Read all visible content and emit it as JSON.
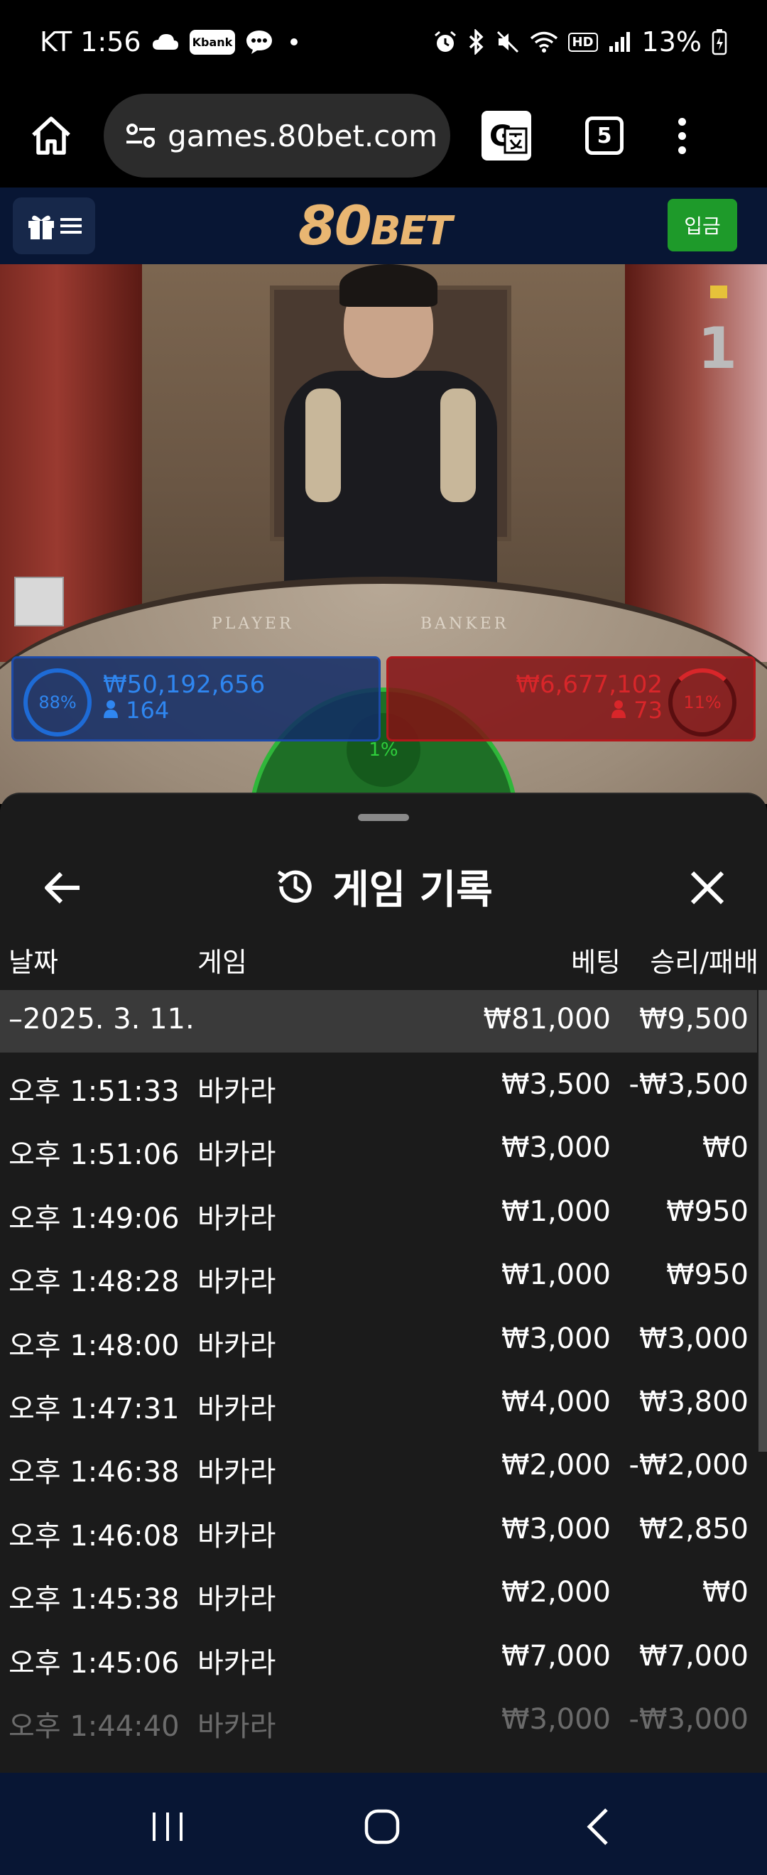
{
  "status_bar": {
    "carrier_time": "KT 1:56",
    "kbank": "Kbank",
    "battery": "13%"
  },
  "browser": {
    "url": "games.80bet.com",
    "tab_count": "5"
  },
  "site": {
    "logo_num": "80",
    "logo_text": "BET",
    "deposit_label": "입금"
  },
  "video": {
    "round": "1",
    "table_player": "PLAYER",
    "table_banker": "BANKER"
  },
  "bets": {
    "player_pct": "88%",
    "player_amount": "₩50,192,656",
    "player_count": "164",
    "banker_pct": "11%",
    "banker_amount": "₩6,677,102",
    "banker_count": "73",
    "tie_pct": "1%"
  },
  "history": {
    "title": "게임 기록",
    "columns": {
      "date": "날짜",
      "game": "게임",
      "bet": "베팅",
      "winloss": "승리/패배"
    },
    "day": {
      "date": "–2025. 3. 11.",
      "bet": "₩81,000",
      "winloss": "₩9,500"
    },
    "rows": [
      {
        "time": "오후 1:51:33",
        "game": "바카라",
        "bet": "₩3,500",
        "winloss": "-₩3,500"
      },
      {
        "time": "오후 1:51:06",
        "game": "바카라",
        "bet": "₩3,000",
        "winloss": "₩0"
      },
      {
        "time": "오후 1:49:06",
        "game": "바카라",
        "bet": "₩1,000",
        "winloss": "₩950"
      },
      {
        "time": "오후 1:48:28",
        "game": "바카라",
        "bet": "₩1,000",
        "winloss": "₩950"
      },
      {
        "time": "오후 1:48:00",
        "game": "바카라",
        "bet": "₩3,000",
        "winloss": "₩3,000"
      },
      {
        "time": "오후 1:47:31",
        "game": "바카라",
        "bet": "₩4,000",
        "winloss": "₩3,800"
      },
      {
        "time": "오후 1:46:38",
        "game": "바카라",
        "bet": "₩2,000",
        "winloss": "-₩2,000"
      },
      {
        "time": "오후 1:46:08",
        "game": "바카라",
        "bet": "₩3,000",
        "winloss": "₩2,850"
      },
      {
        "time": "오후 1:45:38",
        "game": "바카라",
        "bet": "₩2,000",
        "winloss": "₩0"
      },
      {
        "time": "오후 1:45:06",
        "game": "바카라",
        "bet": "₩7,000",
        "winloss": "₩7,000"
      },
      {
        "time": "오후 1:44:40",
        "game": "바카라",
        "bet": "₩3,000",
        "winloss": "-₩3,000"
      }
    ]
  },
  "colors": {
    "player_blue": "#2f86f0",
    "banker_red": "#d8262a",
    "tie_green": "#2fb63a",
    "deposit_green": "#1e9a2a",
    "logo_gold": "#e9b672",
    "sheet_bg": "#1b1b1b"
  }
}
